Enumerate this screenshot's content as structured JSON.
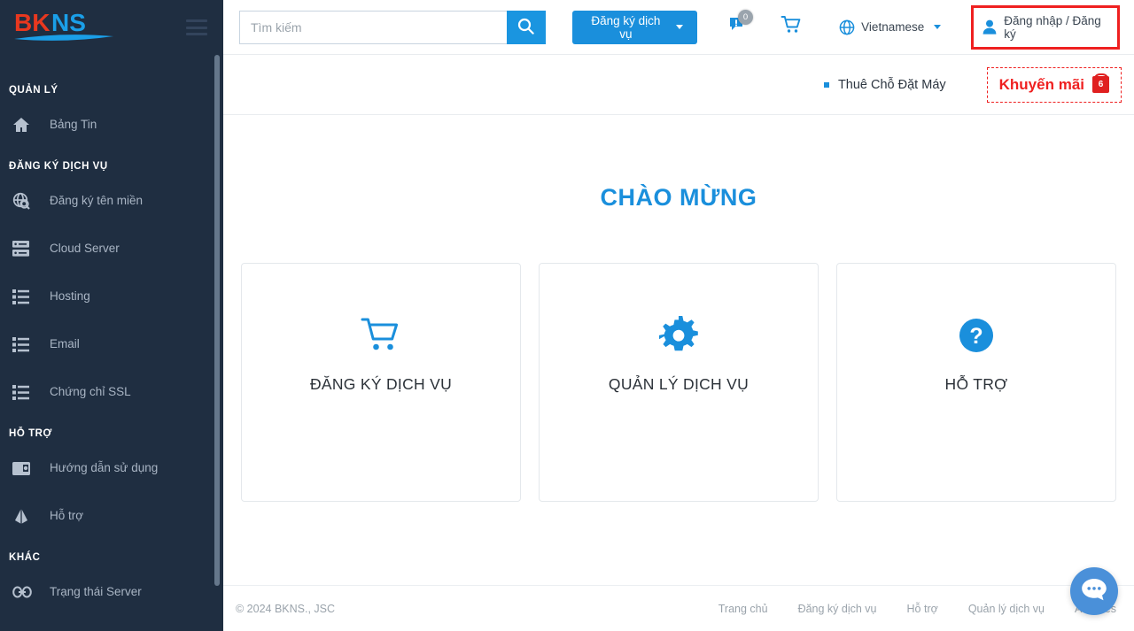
{
  "sidebar": {
    "logo": {
      "part1": "BK",
      "part2": "NS",
      "alt": "BKNS"
    },
    "menu_icon": "hamburger-icon",
    "sections": [
      {
        "label": "QUẢN LÝ",
        "items": [
          {
            "label": "Bảng Tin",
            "icon": "home-icon"
          }
        ]
      },
      {
        "label": "ĐĂNG KÝ DỊCH VỤ",
        "items": [
          {
            "label": "Đăng ký tên miền",
            "icon": "domain-search-icon"
          },
          {
            "label": "Cloud Server",
            "icon": "server-icon"
          },
          {
            "label": "Hosting",
            "icon": "list-icon"
          },
          {
            "label": "Email",
            "icon": "list-icon"
          },
          {
            "label": "Chứng chỉ SSL",
            "icon": "list-icon"
          }
        ]
      },
      {
        "label": "HỖ TRỢ",
        "items": [
          {
            "label": "Hướng dẫn sử dụng",
            "icon": "book-icon"
          },
          {
            "label": "Hỗ trợ",
            "icon": "support-icon"
          }
        ]
      },
      {
        "label": "KHÁC",
        "items": [
          {
            "label": "Trạng thái Server",
            "icon": "link-icon"
          }
        ]
      }
    ]
  },
  "topbar": {
    "search": {
      "placeholder": "Tìm kiếm",
      "value": "",
      "button_icon": "search-icon"
    },
    "register_service_button": {
      "label": "Đăng ký dịch vụ",
      "icon": "chevron-down-icon"
    },
    "notifications": {
      "icon": "notification-flag-icon",
      "badge": "0"
    },
    "cart": {
      "icon": "cart-icon"
    },
    "language": {
      "label": "Vietnamese",
      "icon": "globe-icon",
      "caret": "chevron-down-icon"
    },
    "auth": {
      "label": "Đăng nhập / Đăng ký",
      "icon": "user-icon",
      "highlight_color": "#ef2020"
    }
  },
  "subbar": {
    "items": [
      {
        "label": "Thuê Chỗ Đặt Máy"
      }
    ],
    "promo": {
      "label": "Khuyến mãi",
      "count": "6",
      "icon": "gift-icon",
      "color": "#ef2020"
    }
  },
  "content": {
    "welcome_title": "CHÀO MỪNG",
    "cards": [
      {
        "title": "ĐĂNG KÝ DỊCH VỤ",
        "icon": "cart-icon"
      },
      {
        "title": "QUẢN LÝ DỊCH VỤ",
        "icon": "gear-icon"
      },
      {
        "title": "HỖ TRỢ",
        "icon": "question-circle-icon"
      }
    ]
  },
  "footer": {
    "copyright": "© 2024 BKNS., JSC",
    "links": [
      {
        "label": "Trang chủ"
      },
      {
        "label": "Đăng ký dịch vụ"
      },
      {
        "label": "Hỗ trợ"
      },
      {
        "label": "Quản lý dịch vụ"
      },
      {
        "label": "Affiliates"
      }
    ]
  },
  "chat_widget": {
    "icon": "chat-bubble-icon"
  },
  "colors": {
    "sidebar_bg": "#1f2e41",
    "accent_blue": "#1a8fdc",
    "alert_red": "#ef2020",
    "logo_red": "#e8381f",
    "logo_blue": "#1a8fdc"
  }
}
